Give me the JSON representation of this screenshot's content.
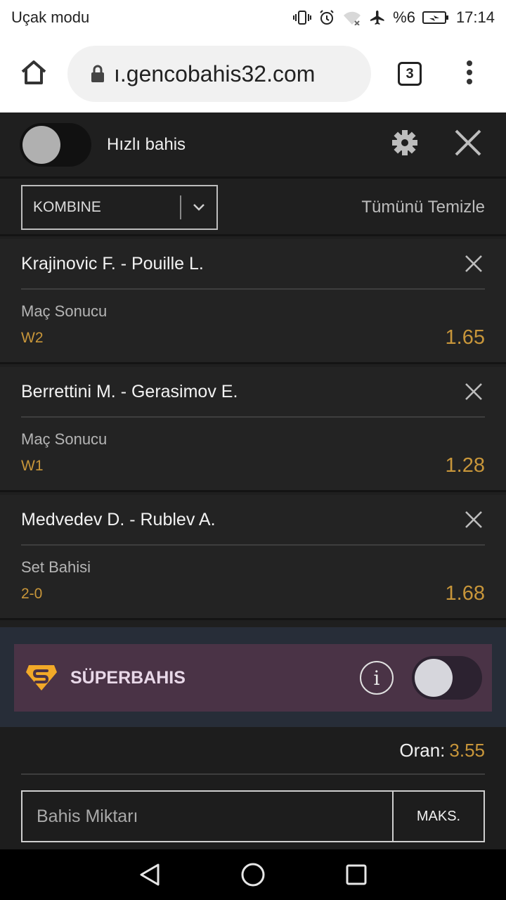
{
  "status_bar": {
    "mode_label": "Uçak modu",
    "battery": "%6",
    "time": "17:14"
  },
  "browser": {
    "url": "ı.gencobahis32.com",
    "tab_count": "3"
  },
  "slip": {
    "quick_bet_label": "Hızlı bahis",
    "bet_type": "KOMBINE",
    "clear_all": "Tümünü Temizle"
  },
  "bets": [
    {
      "teams": "Krajinovic F. - Pouille L.",
      "market": "Maç Sonucu",
      "pick": "W2",
      "odds": "1.65"
    },
    {
      "teams": "Berrettini M. - Gerasimov E.",
      "market": "Maç Sonucu",
      "pick": "W1",
      "odds": "1.28"
    },
    {
      "teams": "Medvedev D. - Rublev A.",
      "market": "Set Bahisi",
      "pick": "2-0",
      "odds": "1.68"
    }
  ],
  "super_bet": {
    "label": "SÜPERBAHIS",
    "info_glyph": "i",
    "logo_icon": "superbahis-logo",
    "enabled": false
  },
  "summary": {
    "odds_label": "Oran:",
    "odds_value": "3.55",
    "stake_placeholder": "Bahis Miktarı",
    "max_label": "MAKS."
  },
  "colors": {
    "accent": "#c8963a",
    "background": "#1f1f1f",
    "super_panel": "#4a3346"
  }
}
